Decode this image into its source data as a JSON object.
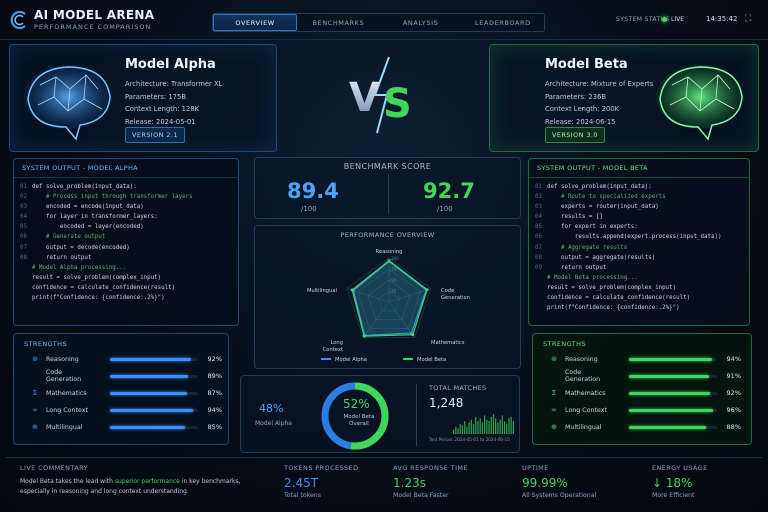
{
  "header": {
    "title": "AI MODEL ARENA",
    "subtitle": "PERFORMANCE COMPARISON",
    "nav": [
      "OVERVIEW",
      "BENCHMARKS",
      "ANALYSIS",
      "LEADERBOARD"
    ],
    "system_status_label": "SYSTEM STATUS",
    "status": "LIVE",
    "time": "14:35:42",
    "fullscreen_icon": "expand-icon"
  },
  "modelA": {
    "name": "Model Alpha",
    "specs": [
      "Architecture:  Transformer XL",
      "Parameters:  175B",
      "Context Length:  128K",
      "Release:  2024-05-01"
    ],
    "version": "VERSION 2.1",
    "color": "#3b8dff"
  },
  "modelB": {
    "name": "Model Beta",
    "specs": [
      "Architecture:  Mixture of Experts",
      "Parameters:  236B",
      "Context Length:  200K",
      "Release:  2024-06-15"
    ],
    "version": "VERSION 3.0",
    "color": "#3fd65c"
  },
  "vs": "VS",
  "codeA": {
    "title": "SYSTEM OUTPUT - MODEL ALPHA",
    "lines": [
      [
        "01",
        "def solve_problem(input_data):"
      ],
      [
        "02",
        "    # Process input through transformer layers"
      ],
      [
        "03",
        "    encoded = encode(input_data)"
      ],
      [
        "04",
        "    for layer in transformer_layers:"
      ],
      [
        "05",
        "        encoded = layer(encoded)"
      ],
      [
        "06",
        "    # Generate output"
      ],
      [
        "07",
        "    output = decode(encoded)"
      ],
      [
        "08",
        "    return output"
      ],
      [
        "",
        ""
      ],
      [
        "",
        "# Model Alpha processing..."
      ],
      [
        "",
        "result = solve_problem(complex_input)"
      ],
      [
        "",
        "confidence = calculate_confidence(result)"
      ],
      [
        "",
        "print(f\"Confidence: {confidence:.2%}\")"
      ]
    ]
  },
  "codeB": {
    "title": "SYSTEM OUTPUT - MODEL BETA",
    "lines": [
      [
        "01",
        "def solve_problem(input_data):"
      ],
      [
        "02",
        "    # Route to specialized experts"
      ],
      [
        "03",
        "    experts = router(input_data)"
      ],
      [
        "04",
        "    results = []"
      ],
      [
        "05",
        "    for expert in experts:"
      ],
      [
        "06",
        "        results.append(expert.process(input_data))"
      ],
      [
        "07",
        "    # Aggregate results"
      ],
      [
        "08",
        "    output = aggregate(results)"
      ],
      [
        "09",
        "    return output"
      ],
      [
        "",
        ""
      ],
      [
        "",
        "# Model Beta processing..."
      ],
      [
        "",
        "result = solve_problem(complex_input)"
      ],
      [
        "",
        "confidence = calculate_confidence(result)"
      ],
      [
        "",
        "print(f\"Confidence: {confidence:.2%}\")"
      ]
    ]
  },
  "benchmark": {
    "title": "BENCHMARK SCORE",
    "alpha": "89.4",
    "beta": "92.7",
    "denom": "/100"
  },
  "chart_data": {
    "type": "radar",
    "title": "PERFORMANCE OVERVIEW",
    "axes": [
      "Reasoning",
      "Code Generation",
      "Mathematics",
      "Long Context",
      "Multilingual"
    ],
    "series": [
      {
        "name": "Model Alpha",
        "values": [
          92,
          89,
          87,
          94,
          85
        ],
        "color": "#3b8dff"
      },
      {
        "name": "Model Beta",
        "values": [
          94,
          91,
          92,
          96,
          88
        ],
        "color": "#3fd65c"
      }
    ],
    "max": 100,
    "ticks": [
      "100",
      "75",
      "50",
      "25"
    ]
  },
  "strengthsA": {
    "title": "STRENGTHS",
    "items": [
      {
        "label": "Reasoning",
        "value": 92,
        "pct": "92%",
        "icon": "network-icon"
      },
      {
        "label": "Code Generation",
        "value": 89,
        "pct": "89%",
        "icon": "code-icon"
      },
      {
        "label": "Mathematics",
        "value": 87,
        "pct": "87%",
        "icon": "sigma-icon"
      },
      {
        "label": "Long Context",
        "value": 94,
        "pct": "94%",
        "icon": "infinity-icon"
      },
      {
        "label": "Multilingual",
        "value": 85,
        "pct": "85%",
        "icon": "globe-icon"
      }
    ]
  },
  "strengthsB": {
    "title": "STRENGTHS",
    "items": [
      {
        "label": "Reasoning",
        "value": 94,
        "pct": "94%",
        "icon": "network-icon"
      },
      {
        "label": "Code Generation",
        "value": 91,
        "pct": "91%",
        "icon": "code-icon"
      },
      {
        "label": "Mathematics",
        "value": 92,
        "pct": "92%",
        "icon": "sigma-icon"
      },
      {
        "label": "Long Context",
        "value": 96,
        "pct": "96%",
        "icon": "infinity-icon"
      },
      {
        "label": "Multilingual",
        "value": 88,
        "pct": "88%",
        "icon": "globe-icon"
      }
    ]
  },
  "winrate": {
    "alpha_pct": "48%",
    "alpha_label": "Model Alpha",
    "beta_pct": "52%",
    "beta_label": "Model Beta",
    "beta_sub": "Overall",
    "beta_share": 0.52
  },
  "matches": {
    "label": "TOTAL MATCHES",
    "value": "1,248",
    "period": "Test Period: 2024-05-01 to 2024-06-15",
    "bars": [
      3,
      5,
      4,
      7,
      6,
      9,
      5,
      8,
      10,
      7,
      12,
      9,
      11,
      8,
      13,
      10,
      9,
      12,
      14,
      11,
      8,
      10,
      13,
      9,
      7,
      11,
      12,
      9
    ]
  },
  "commentary": {
    "label": "LIVE COMMENTARY",
    "pre": "Model Beta takes the lead with ",
    "highlight": "superior performance",
    "post": " in key benchmarks, especially in reasoning and long context understanding."
  },
  "stats": [
    {
      "label": "TOKENS PROCESSED",
      "value": "2.45T",
      "sub": "Total tokens",
      "color": "#3b8dff"
    },
    {
      "label": "AVG RESPONSE TIME",
      "value": "1.23s",
      "sub": "Model Beta Faster",
      "color": "#3fd65c"
    },
    {
      "label": "UPTIME",
      "value": "99.99%",
      "sub": "All Systems Operational",
      "color": "#3fd65c"
    },
    {
      "label": "ENERGY USAGE",
      "value": "↓ 18%",
      "sub": "More Efficient",
      "color": "#3fd65c"
    }
  ]
}
